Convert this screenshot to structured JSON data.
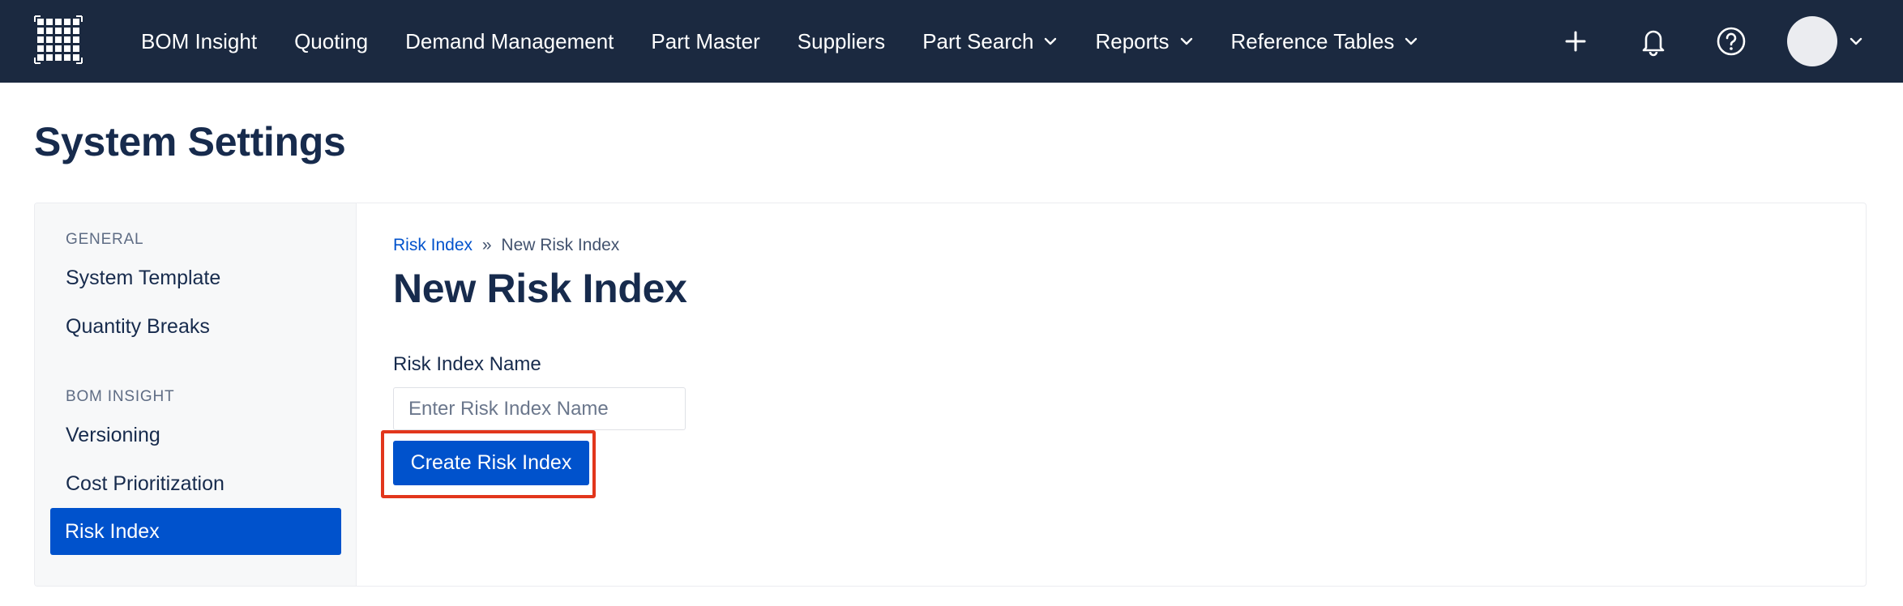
{
  "nav": {
    "items": [
      {
        "label": "BOM Insight",
        "dropdown": false
      },
      {
        "label": "Quoting",
        "dropdown": false
      },
      {
        "label": "Demand Management",
        "dropdown": false
      },
      {
        "label": "Part Master",
        "dropdown": false
      },
      {
        "label": "Suppliers",
        "dropdown": false
      },
      {
        "label": "Part Search",
        "dropdown": true
      },
      {
        "label": "Reports",
        "dropdown": true
      },
      {
        "label": "Reference Tables",
        "dropdown": true
      }
    ],
    "icons": [
      "plus-icon",
      "bell-icon",
      "help-icon",
      "avatar",
      "chevron-down-icon"
    ]
  },
  "page": {
    "title": "System Settings"
  },
  "sidebar": {
    "sections": [
      {
        "heading": "GENERAL",
        "items": [
          {
            "label": "System Template",
            "active": false
          },
          {
            "label": "Quantity Breaks",
            "active": false
          }
        ]
      },
      {
        "heading": "BOM INSIGHT",
        "items": [
          {
            "label": "Versioning",
            "active": false
          },
          {
            "label": "Cost Prioritization",
            "active": false
          },
          {
            "label": "Risk Index",
            "active": true
          }
        ]
      }
    ]
  },
  "content": {
    "breadcrumb": {
      "link": "Risk Index",
      "separator": "»",
      "current": "New Risk Index"
    },
    "title": "New Risk Index",
    "form": {
      "label": "Risk Index Name",
      "placeholder": "Enter Risk Index Name",
      "value": "",
      "submit_label": "Create Risk Index"
    }
  },
  "colors": {
    "nav_bg": "#1b2940",
    "primary": "#0052cc",
    "highlight": "#e2361c"
  }
}
